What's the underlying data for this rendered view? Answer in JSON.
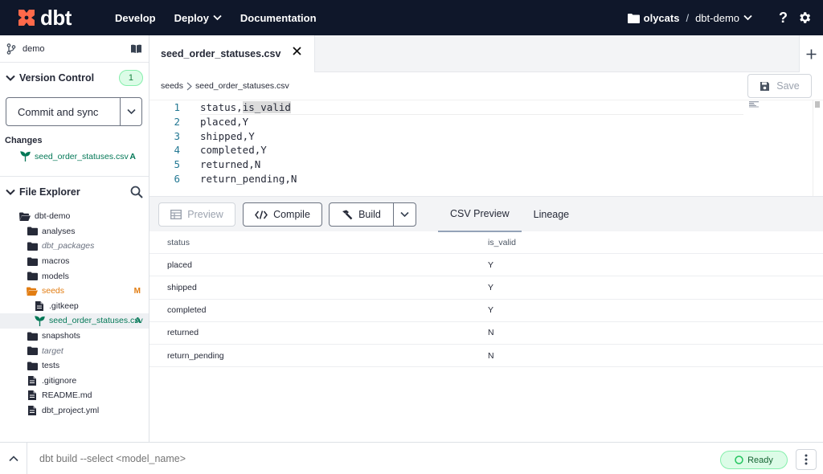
{
  "topbar": {
    "logo_text": "dbt",
    "nav": [
      "Develop",
      "Deploy",
      "Documentation"
    ],
    "account": "olycats",
    "project": "dbt-demo",
    "help": "?"
  },
  "sidebar": {
    "branch": "demo",
    "version_control": {
      "title": "Version Control",
      "count": "1",
      "commit_label": "Commit and sync",
      "changes_label": "Changes",
      "changes": [
        {
          "file": "seed_order_statuses.csv",
          "status": "A"
        }
      ]
    },
    "file_explorer": {
      "title": "File Explorer",
      "tree": [
        {
          "label": "dbt-demo",
          "type": "folder-open",
          "indent": 0
        },
        {
          "label": "analyses",
          "type": "folder",
          "indent": 1
        },
        {
          "label": "dbt_packages",
          "type": "folder",
          "indent": 1,
          "italic": true
        },
        {
          "label": "macros",
          "type": "folder",
          "indent": 1
        },
        {
          "label": "models",
          "type": "folder",
          "indent": 1
        },
        {
          "label": "seeds",
          "type": "folder-open",
          "indent": 1,
          "mark": "M",
          "color": "orange"
        },
        {
          "label": ".gitkeep",
          "type": "file",
          "indent": 2
        },
        {
          "label": "seed_order_statuses.csv",
          "type": "seed",
          "indent": 2,
          "mark": "A",
          "color": "green",
          "selected": true
        },
        {
          "label": "snapshots",
          "type": "folder",
          "indent": 1
        },
        {
          "label": "target",
          "type": "folder",
          "indent": 1,
          "italic": true
        },
        {
          "label": "tests",
          "type": "folder",
          "indent": 1
        },
        {
          "label": ".gitignore",
          "type": "file",
          "indent": 1
        },
        {
          "label": "README.md",
          "type": "file",
          "indent": 1
        },
        {
          "label": "dbt_project.yml",
          "type": "file",
          "indent": 1
        }
      ]
    }
  },
  "editor": {
    "tab_label": "seed_order_statuses.csv",
    "breadcrumb": [
      "seeds",
      "seed_order_statuses.csv"
    ],
    "save_label": "Save",
    "lines": [
      "status,is_valid",
      "placed,Y",
      "shipped,Y",
      "completed,Y",
      "returned,N",
      "return_pending,N"
    ]
  },
  "actions": {
    "preview": "Preview",
    "compile": "Compile",
    "build": "Build",
    "tabs": [
      "CSV Preview",
      "Lineage"
    ]
  },
  "csv_preview": {
    "headers": [
      "status",
      "is_valid"
    ],
    "rows": [
      [
        "placed",
        "Y"
      ],
      [
        "shipped",
        "Y"
      ],
      [
        "completed",
        "Y"
      ],
      [
        "returned",
        "N"
      ],
      [
        "return_pending",
        "N"
      ]
    ]
  },
  "command_bar": {
    "placeholder": "dbt build --select <model_name>",
    "status": "Ready"
  },
  "colors": {
    "brand": "#ff694a",
    "nav_bg": "#0f172a",
    "ready_green": "#22c55e",
    "modified": "#e27d12",
    "added": "#047857"
  }
}
